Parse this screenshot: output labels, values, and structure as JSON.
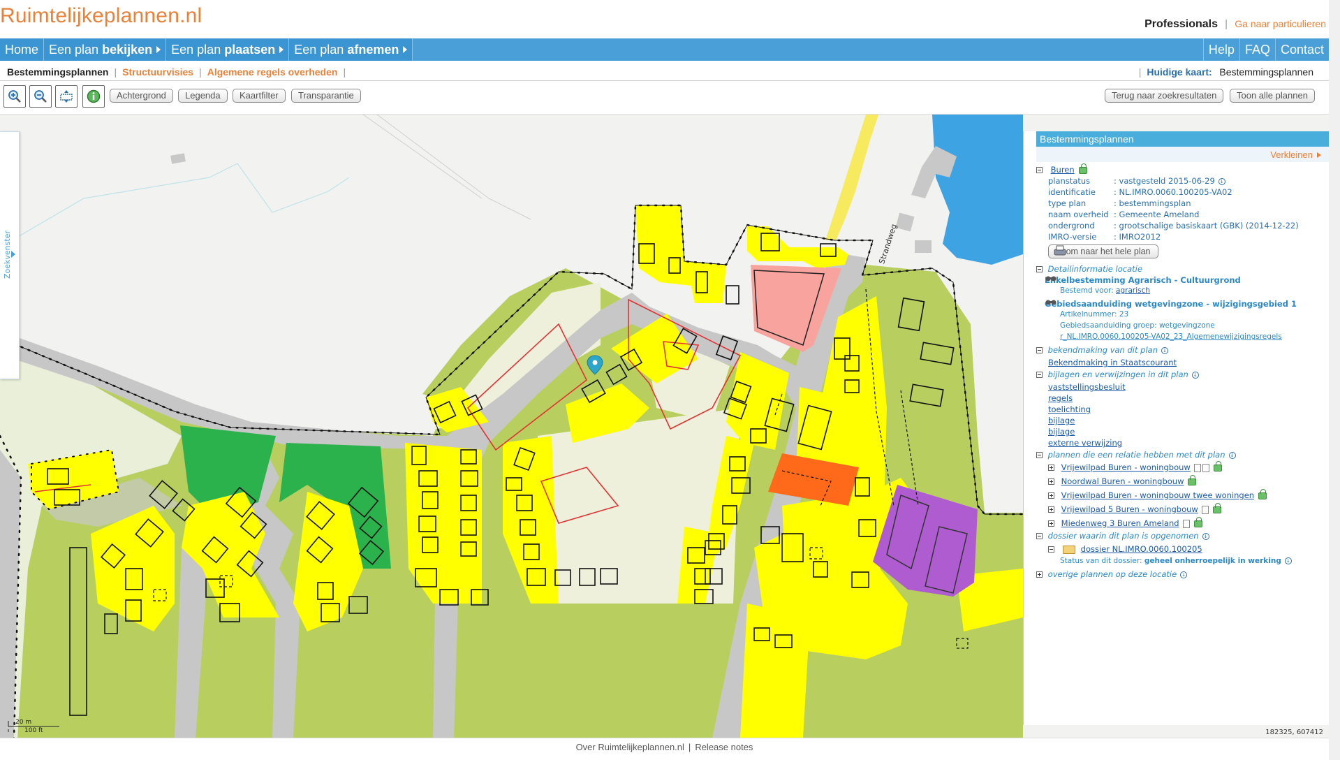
{
  "site": {
    "logo": "Ruimtelijkeplannen.nl",
    "professionals": "Professionals",
    "separator": "|",
    "particulieren": "Ga naar particulieren"
  },
  "mainnav": {
    "home": "Home",
    "bekijken_pre": "Een plan",
    "bekijken_b": "bekijken",
    "plaatsen_pre": "Een plan",
    "plaatsen_b": "plaatsen",
    "afnemen_pre": "Een plan",
    "afnemen_b": "afnemen",
    "help": "Help",
    "faq": "FAQ",
    "contact": "Contact"
  },
  "subnav": {
    "bestemmingsplannen": "Bestemmingsplannen",
    "structuurvisies": "Structuurvisies",
    "algemene_regels": "Algemene regels overheden",
    "bar": "|",
    "huidige_kaart_label": "Huidige kaart:",
    "huidige_kaart_value": "Bestemmingsplannen"
  },
  "toolbar": {
    "achtergrond": "Achtergrond",
    "legenda": "Legenda",
    "kaartfilter": "Kaartfilter",
    "transparantie": "Transparantie",
    "terug": "Terug naar zoekresultaten",
    "toon_alle": "Toon alle plannen"
  },
  "map": {
    "zoekvenster": "Zoekvenster",
    "street": "Strandweg",
    "scale_m": "20 m",
    "scale_ft": "100 ft",
    "coords": "182325, 607412"
  },
  "panel": {
    "title": "Bestemmingsplannen",
    "verkleinen": "Verkleinen",
    "plan_name": "Buren",
    "fields": [
      {
        "label": "planstatus",
        "value": ": vastgesteld 2015-06-29"
      },
      {
        "label": "identificatie",
        "value": ": NL.IMRO.0060.100205-VA02"
      },
      {
        "label": "type plan",
        "value": ": bestemmingsplan"
      },
      {
        "label": "naam overheid",
        "value": ": Gemeente Ameland"
      },
      {
        "label": "ondergrond",
        "value": ": grootschalige basiskaart (GBK) (2014-12-22)"
      },
      {
        "label": "IMRO-versie",
        "value": ": IMRO2012"
      }
    ],
    "zoom_button": "Zoom naar het hele plan",
    "detail_title": "Detailinformatie locatie",
    "enkel_title": "Enkelbestemming Agrarisch - Cultuurgrond",
    "bestemd_label": "Bestemd voor:",
    "bestemd_value": "agrarisch",
    "gebied_title": "Gebiedsaanduiding wetgevingzone - wijzigingsgebied 1",
    "artikel": "Artikelnummer: 23",
    "gebied_groep": "Gebiedsaanduiding groep: wetgevingzone",
    "regels_link": "r_NL.IMRO.0060.100205-VA02_23_Algemenewijzigingsregels",
    "bekendmaking_title": "bekendmaking van dit plan",
    "bekendmaking_link": "Bekendmaking in Staatscourant",
    "bijlagen_title": "bijlagen en verwijzingen in dit plan",
    "bijlagen": [
      "vaststellingsbesluit",
      "regels",
      "toelichting",
      "bijlage",
      "bijlage",
      "externe verwijzing"
    ],
    "relatie_title": "plannen die een relatie hebben met dit plan",
    "relaties": [
      "Vrijewilpad Buren - woningbouw",
      "Noordwal Buren - woningbouw",
      "Vrijewilpad Buren - woningbouw twee woningen",
      "Vrijewilpad 5 Buren - woningbouw",
      "Miedenweg 3 Buren Ameland"
    ],
    "dossier_title": "dossier waarin dit plan is opgenomen",
    "dossier_link": "dossier NL.IMRO.0060.100205",
    "dossier_status_label": "Status van dit dossier:",
    "dossier_status_value": "geheel onherroepelijk in werking",
    "overige_title": "overige plannen op deze locatie"
  },
  "footer": {
    "over": "Over Ruimtelijkeplannen.nl",
    "bar": "|",
    "release": "Release notes"
  },
  "colors": {
    "nav_blue": "#4a9fd8",
    "accent_orange": "#e8823a",
    "link_blue": "#1a5aa8"
  }
}
